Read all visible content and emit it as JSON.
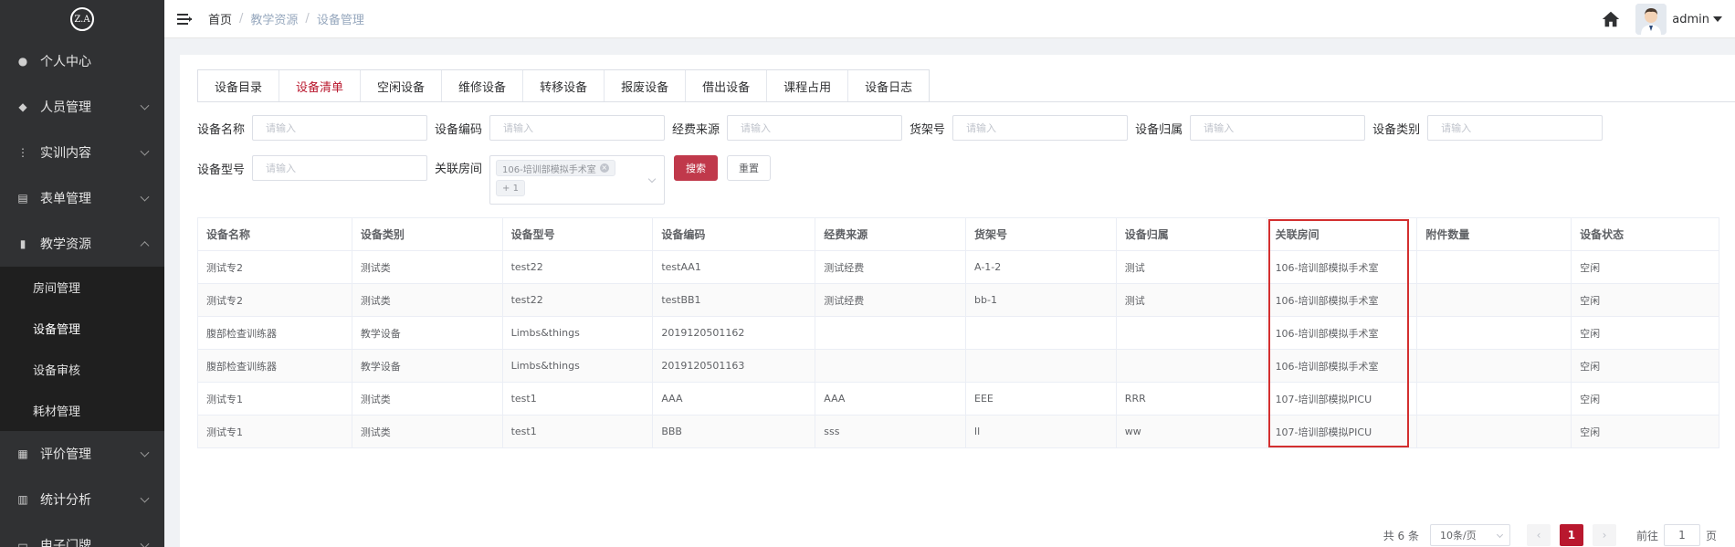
{
  "logo": {
    "text": "Z.A"
  },
  "sidebar": {
    "items_top": [
      {
        "label": "个人中心",
        "icon": "user-icon",
        "has_arrow": false
      },
      {
        "label": "人员管理",
        "icon": "users-icon",
        "has_arrow": true
      },
      {
        "label": "实训内容",
        "icon": "tree-icon",
        "has_arrow": true
      },
      {
        "label": "表单管理",
        "icon": "form-icon",
        "has_arrow": true
      },
      {
        "label": "教学资源",
        "icon": "book-icon",
        "has_arrow": true,
        "expanded": true
      }
    ],
    "submenu": [
      {
        "label": "房间管理"
      },
      {
        "label": "设备管理",
        "active": true
      },
      {
        "label": "设备审核"
      },
      {
        "label": "耗材管理"
      }
    ],
    "items_bottom": [
      {
        "label": "评价管理",
        "icon": "eval-icon",
        "has_arrow": true
      },
      {
        "label": "统计分析",
        "icon": "chart-icon",
        "has_arrow": true
      },
      {
        "label": "电子门牌",
        "icon": "door-icon",
        "has_arrow": true
      }
    ]
  },
  "header": {
    "breadcrumb": [
      "首页",
      "教学资源",
      "设备管理"
    ],
    "username": "admin"
  },
  "tabs": [
    "设备目录",
    "设备清单",
    "空闲设备",
    "维修设备",
    "转移设备",
    "报废设备",
    "借出设备",
    "课程占用",
    "设备日志"
  ],
  "active_tab": "设备清单",
  "filters": {
    "name_label": "设备名称",
    "name_placeholder": "请输入",
    "code_label": "设备编码",
    "code_placeholder": "请输入",
    "fund_label": "经费来源",
    "fund_placeholder": "请输入",
    "shelf_label": "货架号",
    "shelf_placeholder": "请输入",
    "owner_label": "设备归属",
    "owner_placeholder": "请输入",
    "category_label": "设备类别",
    "category_placeholder": "请输入",
    "model_label": "设备型号",
    "model_placeholder": "请输入",
    "room_label": "关联房间",
    "room_tag": "106-培训部模拟手术室",
    "room_more": "+ 1",
    "search_label": "搜索",
    "reset_label": "重置"
  },
  "table": {
    "headers": [
      "设备名称",
      "设备类别",
      "设备型号",
      "设备编码",
      "经费来源",
      "货架号",
      "设备归属",
      "关联房间",
      "附件数量",
      "设备状态"
    ],
    "rows": [
      [
        "测试专2",
        "测试类",
        "test22",
        "testAA1",
        "测试经费",
        "A-1-2",
        "测试",
        "106-培训部模拟手术室",
        "",
        "空闲"
      ],
      [
        "测试专2",
        "测试类",
        "test22",
        "testBB1",
        "测试经费",
        "bb-1",
        "测试",
        "106-培训部模拟手术室",
        "",
        "空闲"
      ],
      [
        "腹部检查训练器",
        "教学设备",
        "Limbs&things",
        "2019120501162",
        "",
        "",
        "",
        "106-培训部模拟手术室",
        "",
        "空闲"
      ],
      [
        "腹部检查训练器",
        "教学设备",
        "Limbs&things",
        "2019120501163",
        "",
        "",
        "",
        "106-培训部模拟手术室",
        "",
        "空闲"
      ],
      [
        "测试专1",
        "测试类",
        "test1",
        "AAA",
        "AAA",
        "EEE",
        "RRR",
        "107-培训部模拟PICU",
        "",
        "空闲"
      ],
      [
        "测试专1",
        "测试类",
        "test1",
        "BBB",
        "sss",
        "ll",
        "ww",
        "107-培训部模拟PICU",
        "",
        "空闲"
      ]
    ]
  },
  "pagination": {
    "total_text": "共 6 条",
    "page_size": "10条/页",
    "prev": "‹",
    "next": "›",
    "current_page": "1",
    "goto_prefix": "前往",
    "goto_value": "1",
    "goto_suffix": "页"
  },
  "colors": {
    "accent": "#b9182e",
    "sidebar_bg": "#303133",
    "submenu_bg": "#1f1f1f",
    "highlight": "#d32f2f"
  }
}
